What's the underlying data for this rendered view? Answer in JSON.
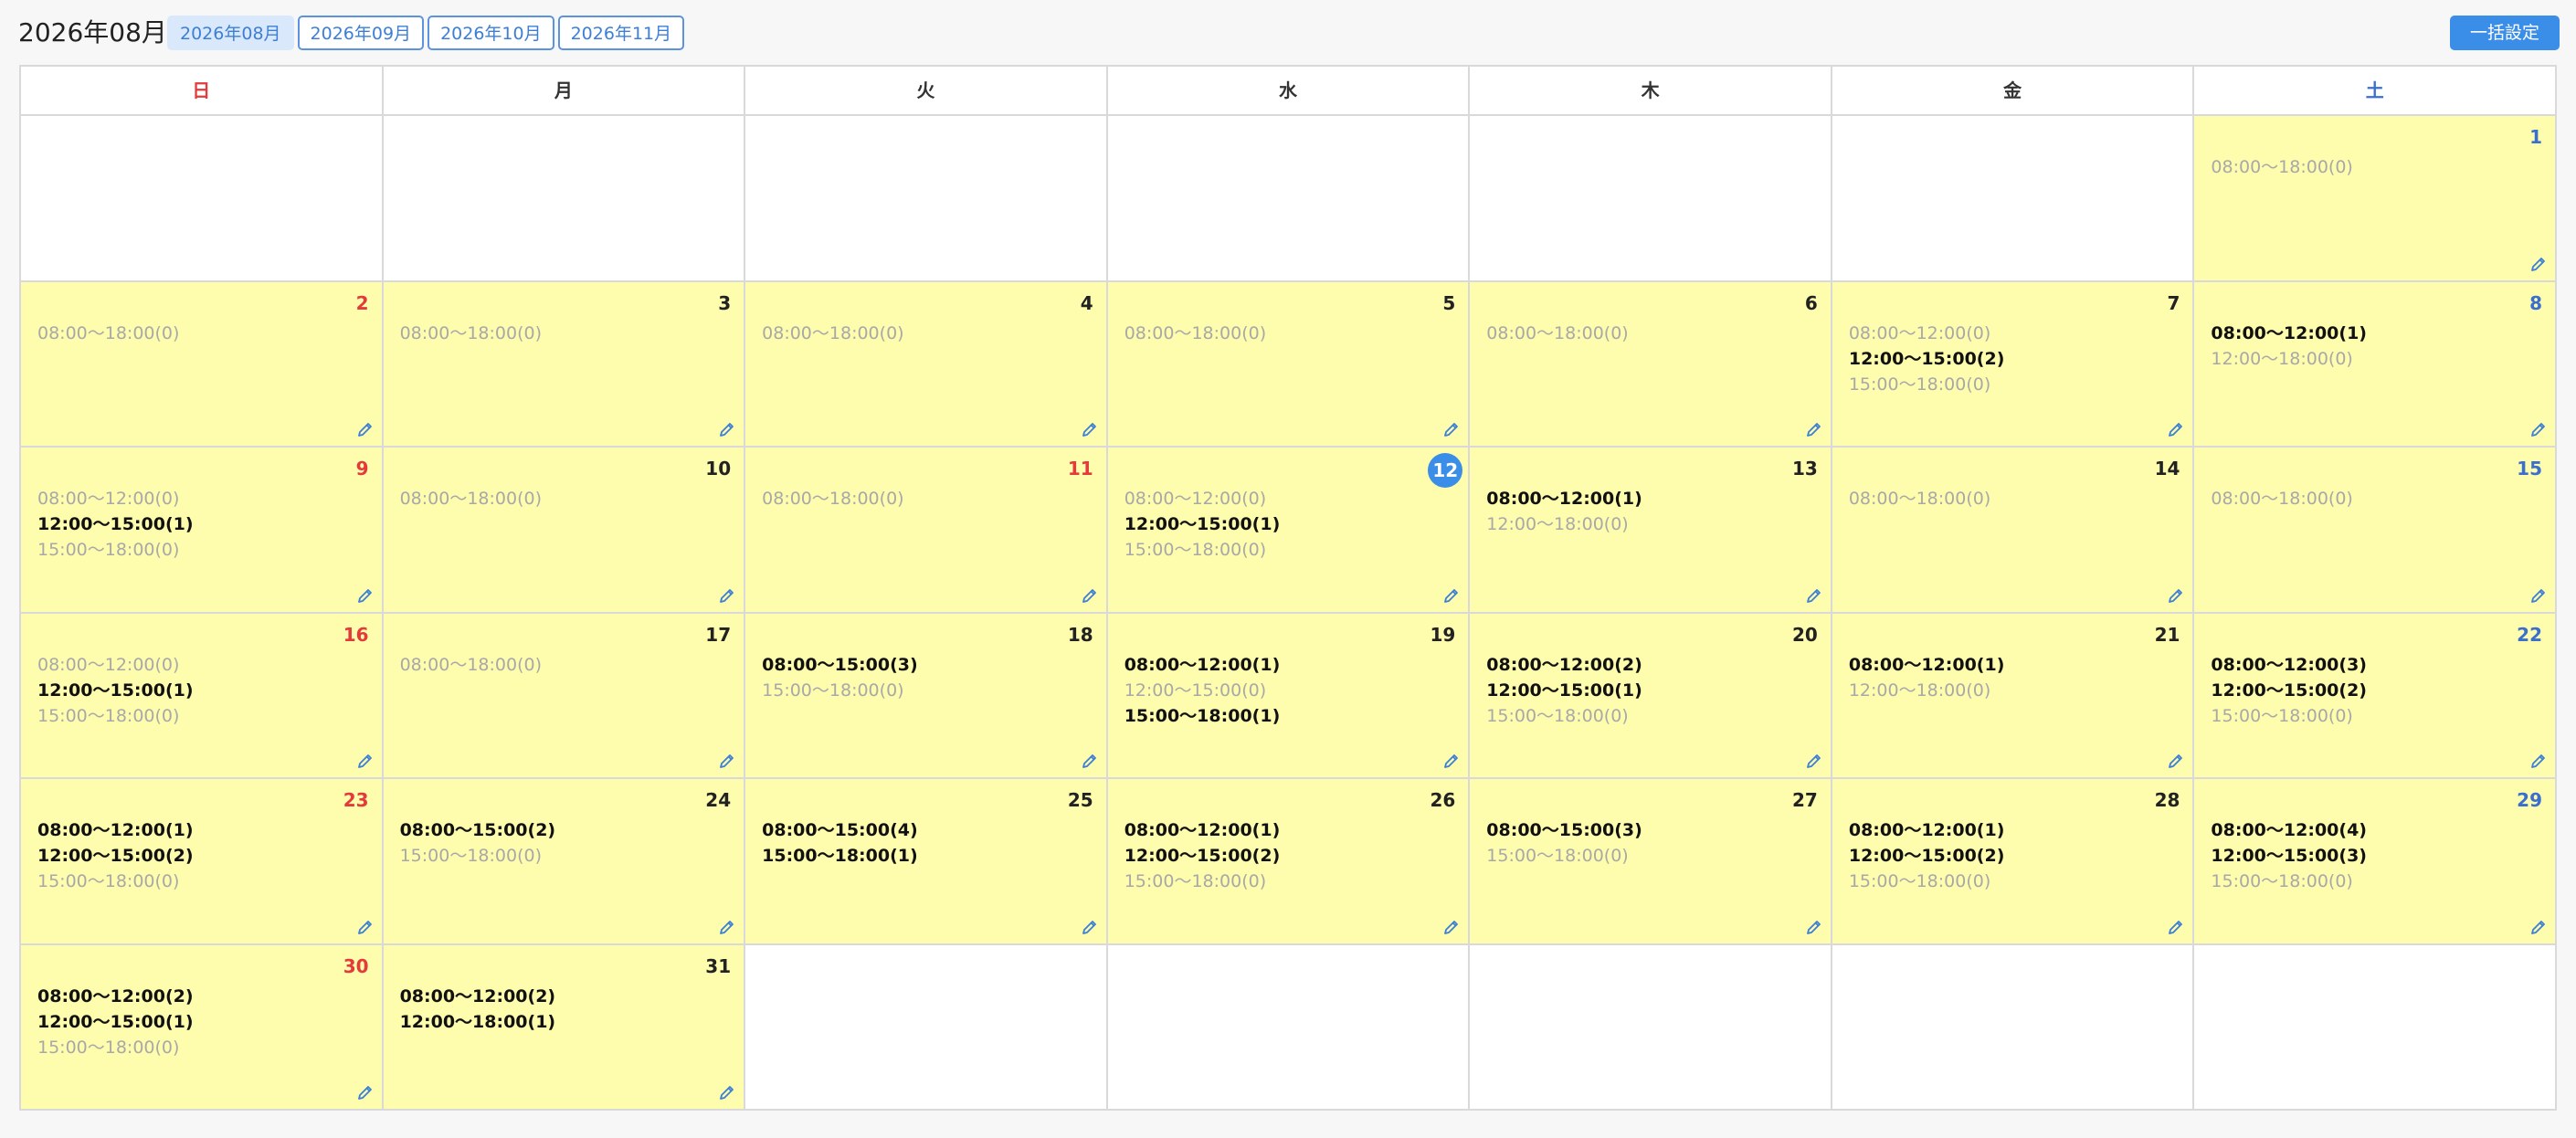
{
  "header": {
    "title": "2026年08月",
    "tabs": [
      "2026年08月",
      "2026年09月",
      "2026年10月",
      "2026年11月"
    ],
    "active_tab": 0,
    "bulk_label": "一括設定"
  },
  "colors": {
    "accent": "#3b8ee8",
    "cell_bg": "#fefcad",
    "sunday": "#e33b3b",
    "saturday": "#3a6fd0"
  },
  "weekdays": [
    "日",
    "月",
    "火",
    "水",
    "木",
    "金",
    "土"
  ],
  "today": 12,
  "weeks": [
    [
      null,
      null,
      null,
      null,
      null,
      null,
      {
        "day": "1",
        "slots": [
          {
            "t": "08:00〜18:00(0)",
            "b": false
          }
        ]
      }
    ],
    [
      {
        "day": "2",
        "slots": [
          {
            "t": "08:00〜18:00(0)",
            "b": false
          }
        ]
      },
      {
        "day": "3",
        "slots": [
          {
            "t": "08:00〜18:00(0)",
            "b": false
          }
        ]
      },
      {
        "day": "4",
        "slots": [
          {
            "t": "08:00〜18:00(0)",
            "b": false
          }
        ]
      },
      {
        "day": "5",
        "slots": [
          {
            "t": "08:00〜18:00(0)",
            "b": false
          }
        ]
      },
      {
        "day": "6",
        "slots": [
          {
            "t": "08:00〜18:00(0)",
            "b": false
          }
        ]
      },
      {
        "day": "7",
        "slots": [
          {
            "t": "08:00〜12:00(0)",
            "b": false
          },
          {
            "t": "12:00〜15:00(2)",
            "b": true
          },
          {
            "t": "15:00〜18:00(0)",
            "b": false
          }
        ]
      },
      {
        "day": "8",
        "slots": [
          {
            "t": "08:00〜12:00(1)",
            "b": true
          },
          {
            "t": "12:00〜18:00(0)",
            "b": false
          }
        ]
      }
    ],
    [
      {
        "day": "9",
        "slots": [
          {
            "t": "08:00〜12:00(0)",
            "b": false
          },
          {
            "t": "12:00〜15:00(1)",
            "b": true
          },
          {
            "t": "15:00〜18:00(0)",
            "b": false
          }
        ]
      },
      {
        "day": "10",
        "slots": [
          {
            "t": "08:00〜18:00(0)",
            "b": false
          }
        ]
      },
      {
        "day": "11",
        "red": true,
        "slots": [
          {
            "t": "08:00〜18:00(0)",
            "b": false
          }
        ]
      },
      {
        "day": "12",
        "slots": [
          {
            "t": "08:00〜12:00(0)",
            "b": false
          },
          {
            "t": "12:00〜15:00(1)",
            "b": true
          },
          {
            "t": "15:00〜18:00(0)",
            "b": false
          }
        ]
      },
      {
        "day": "13",
        "slots": [
          {
            "t": "08:00〜12:00(1)",
            "b": true
          },
          {
            "t": "12:00〜18:00(0)",
            "b": false
          }
        ]
      },
      {
        "day": "14",
        "slots": [
          {
            "t": "08:00〜18:00(0)",
            "b": false
          }
        ]
      },
      {
        "day": "15",
        "slots": [
          {
            "t": "08:00〜18:00(0)",
            "b": false
          }
        ]
      }
    ],
    [
      {
        "day": "16",
        "slots": [
          {
            "t": "08:00〜12:00(0)",
            "b": false
          },
          {
            "t": "12:00〜15:00(1)",
            "b": true
          },
          {
            "t": "15:00〜18:00(0)",
            "b": false
          }
        ]
      },
      {
        "day": "17",
        "slots": [
          {
            "t": "08:00〜18:00(0)",
            "b": false
          }
        ]
      },
      {
        "day": "18",
        "slots": [
          {
            "t": "08:00〜15:00(3)",
            "b": true
          },
          {
            "t": "15:00〜18:00(0)",
            "b": false
          }
        ]
      },
      {
        "day": "19",
        "slots": [
          {
            "t": "08:00〜12:00(1)",
            "b": true
          },
          {
            "t": "12:00〜15:00(0)",
            "b": false
          },
          {
            "t": "15:00〜18:00(1)",
            "b": true
          }
        ]
      },
      {
        "day": "20",
        "slots": [
          {
            "t": "08:00〜12:00(2)",
            "b": true
          },
          {
            "t": "12:00〜15:00(1)",
            "b": true
          },
          {
            "t": "15:00〜18:00(0)",
            "b": false
          }
        ]
      },
      {
        "day": "21",
        "slots": [
          {
            "t": "08:00〜12:00(1)",
            "b": true
          },
          {
            "t": "12:00〜18:00(0)",
            "b": false
          }
        ]
      },
      {
        "day": "22",
        "slots": [
          {
            "t": "08:00〜12:00(3)",
            "b": true
          },
          {
            "t": "12:00〜15:00(2)",
            "b": true
          },
          {
            "t": "15:00〜18:00(0)",
            "b": false
          }
        ]
      }
    ],
    [
      {
        "day": "23",
        "slots": [
          {
            "t": "08:00〜12:00(1)",
            "b": true
          },
          {
            "t": "12:00〜15:00(2)",
            "b": true
          },
          {
            "t": "15:00〜18:00(0)",
            "b": false
          }
        ]
      },
      {
        "day": "24",
        "slots": [
          {
            "t": "08:00〜15:00(2)",
            "b": true
          },
          {
            "t": "15:00〜18:00(0)",
            "b": false
          }
        ]
      },
      {
        "day": "25",
        "slots": [
          {
            "t": "08:00〜15:00(4)",
            "b": true
          },
          {
            "t": "15:00〜18:00(1)",
            "b": true
          }
        ]
      },
      {
        "day": "26",
        "slots": [
          {
            "t": "08:00〜12:00(1)",
            "b": true
          },
          {
            "t": "12:00〜15:00(2)",
            "b": true
          },
          {
            "t": "15:00〜18:00(0)",
            "b": false
          }
        ]
      },
      {
        "day": "27",
        "slots": [
          {
            "t": "08:00〜15:00(3)",
            "b": true
          },
          {
            "t": "15:00〜18:00(0)",
            "b": false
          }
        ]
      },
      {
        "day": "28",
        "slots": [
          {
            "t": "08:00〜12:00(1)",
            "b": true
          },
          {
            "t": "12:00〜15:00(2)",
            "b": true
          },
          {
            "t": "15:00〜18:00(0)",
            "b": false
          }
        ]
      },
      {
        "day": "29",
        "slots": [
          {
            "t": "08:00〜12:00(4)",
            "b": true
          },
          {
            "t": "12:00〜15:00(3)",
            "b": true
          },
          {
            "t": "15:00〜18:00(0)",
            "b": false
          }
        ]
      }
    ],
    [
      {
        "day": "30",
        "slots": [
          {
            "t": "08:00〜12:00(2)",
            "b": true
          },
          {
            "t": "12:00〜15:00(1)",
            "b": true
          },
          {
            "t": "15:00〜18:00(0)",
            "b": false
          }
        ]
      },
      {
        "day": "31",
        "slots": [
          {
            "t": "08:00〜12:00(2)",
            "b": true
          },
          {
            "t": "12:00〜18:00(1)",
            "b": true
          }
        ]
      },
      null,
      null,
      null,
      null,
      null
    ]
  ]
}
